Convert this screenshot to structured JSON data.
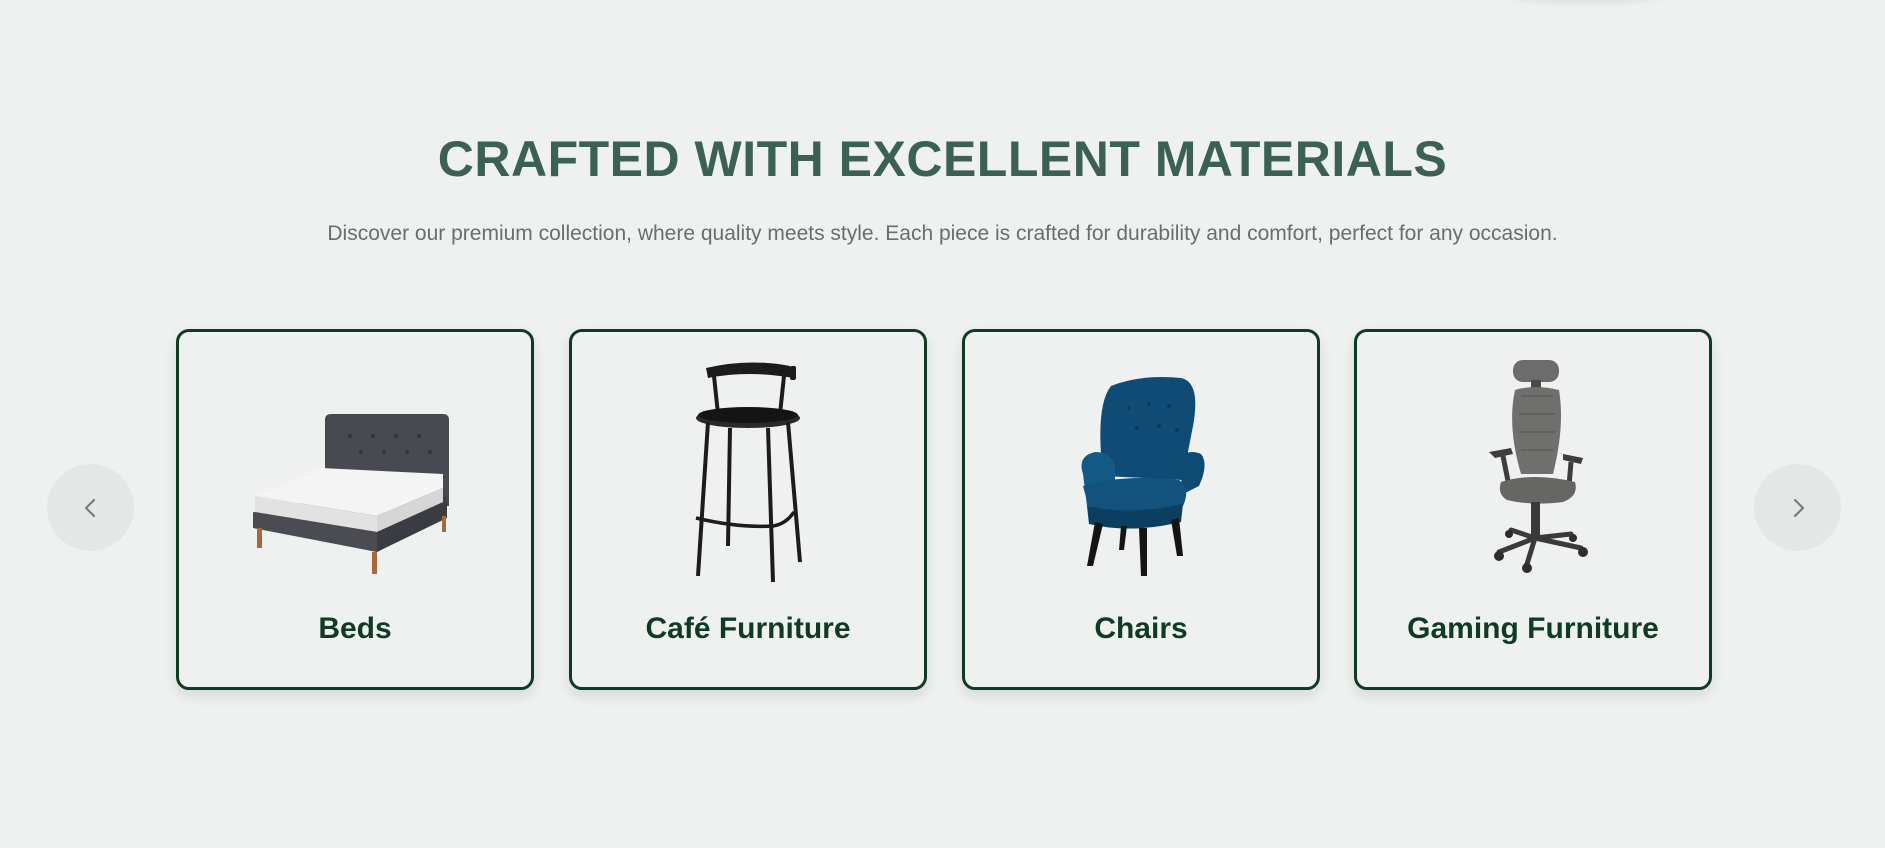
{
  "section": {
    "title": "CRAFTED WITH EXCELLENT MATERIALS",
    "subtitle": "Discover our premium collection, where quality meets style. Each piece is crafted for durability and comfort, perfect for any occasion."
  },
  "carousel": {
    "prev_icon": "chevron-left-icon",
    "next_icon": "chevron-right-icon",
    "items": [
      {
        "label": "Beds",
        "image": "bed-image"
      },
      {
        "label": "Café Furniture",
        "image": "bar-stool-image"
      },
      {
        "label": "Chairs",
        "image": "armchair-image"
      },
      {
        "label": "Gaming Furniture",
        "image": "gaming-chair-image"
      }
    ]
  },
  "colors": {
    "background": "#eff1f0",
    "title": "#3b6153",
    "card_border": "#0f3a24",
    "card_label": "#0f3a24",
    "subtitle": "#6a6d6b",
    "nav_button": "#e4e7e6"
  }
}
